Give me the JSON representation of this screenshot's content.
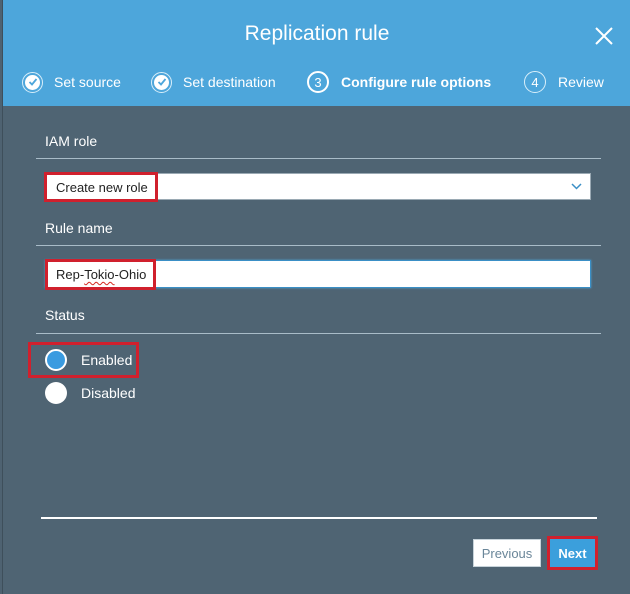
{
  "dialog": {
    "title": "Replication rule",
    "close_icon": "close-icon"
  },
  "steps": [
    {
      "label": "Set source",
      "state": "done",
      "icon": "check-circle-icon"
    },
    {
      "label": "Set destination",
      "state": "done",
      "icon": "check-circle-icon"
    },
    {
      "label": "Configure rule options",
      "state": "current",
      "number": "3"
    },
    {
      "label": "Review",
      "state": "upcoming",
      "number": "4"
    }
  ],
  "form": {
    "iam_role": {
      "label": "IAM role",
      "value": "Create new role"
    },
    "rule_name": {
      "label": "Rule name",
      "value_parts": [
        "Rep-",
        "Tokio",
        "-Ohio"
      ]
    },
    "status": {
      "label": "Status",
      "options": [
        {
          "label": "Enabled",
          "selected": true
        },
        {
          "label": "Disabled",
          "selected": false
        }
      ]
    }
  },
  "footer": {
    "previous_label": "Previous",
    "next_label": "Next"
  },
  "colors": {
    "header_bg": "#4da6db",
    "body_bg": "#4f6473",
    "highlight": "#d0202d",
    "primary_button": "#3b9fdc"
  }
}
